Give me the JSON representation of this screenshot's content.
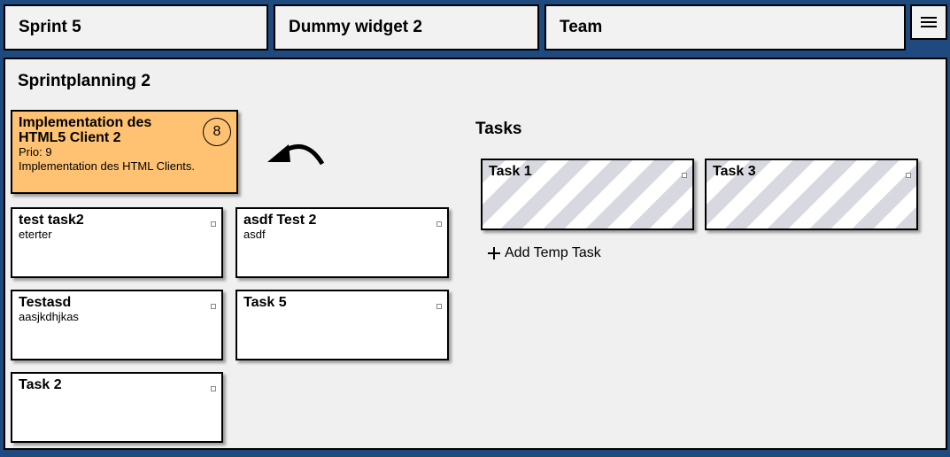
{
  "tabs": [
    {
      "label": "Sprint 5"
    },
    {
      "label": "Dummy widget 2"
    },
    {
      "label": "Team"
    }
  ],
  "menu_icon": "hamburger-menu-icon",
  "panel": {
    "title": "Sprintplanning 2",
    "selected_story": {
      "title": "Implementation des HTML5 Client 2",
      "estimate": "8",
      "prio": "Prio: 9",
      "description": "Implementation des HTML Clients.",
      "color": "#ffc273"
    },
    "undo_icon": "undo-arrow-icon",
    "stories": [
      {
        "title": "test task2",
        "description": "eterter"
      },
      {
        "title": "asdf Test 2",
        "description": "asdf"
      },
      {
        "title": "Testasd",
        "description": "aasjkdhjkas"
      },
      {
        "title": "Task 5",
        "description": ""
      },
      {
        "title": "Task 2",
        "description": ""
      }
    ],
    "tasks_title": "Tasks",
    "tasks": [
      {
        "title": "Task 1"
      },
      {
        "title": "Task 3"
      }
    ],
    "add_temp_task_label": "Add Temp Task"
  },
  "colors": {
    "background": "#1e4a80",
    "panel": "#f0f0f0",
    "selected_card": "#ffc273"
  }
}
